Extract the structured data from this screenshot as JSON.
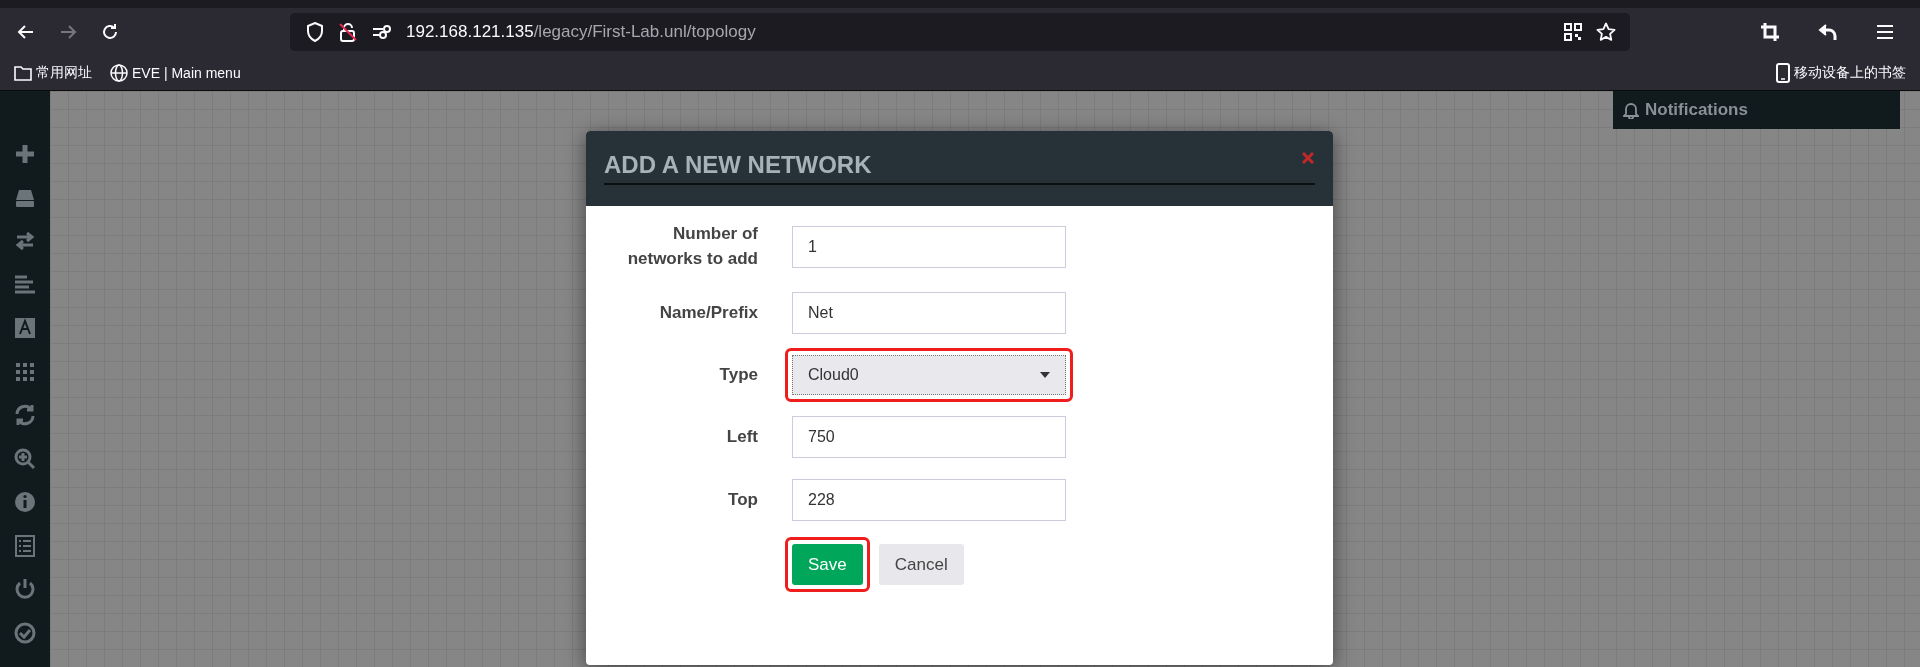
{
  "browser": {
    "nav_buttons": [
      {
        "kind": "back",
        "disabled": false
      },
      {
        "kind": "forward",
        "disabled": true
      },
      {
        "kind": "reload",
        "disabled": false
      }
    ],
    "url": {
      "host": "192.168.121.135",
      "path": "/legacy/First-Lab.unl/topology"
    },
    "bookmarks": [
      {
        "kind": "folder",
        "label": "常用网址"
      },
      {
        "kind": "site",
        "label": "EVE | Main menu"
      }
    ],
    "mobile_bookmarks": "移动设备上的书签"
  },
  "notifications": {
    "title": "Notifications"
  },
  "dialog": {
    "title": "ADD A NEW NETWORK",
    "fields": [
      {
        "kind": "text",
        "label": "Number of networks to add",
        "value": "1",
        "highlighted": false
      },
      {
        "kind": "text",
        "label": "Name/Prefix",
        "value": "Net",
        "highlighted": false
      },
      {
        "kind": "select",
        "label": "Type",
        "value": "Cloud0",
        "highlighted": true
      },
      {
        "kind": "text",
        "label": "Left",
        "value": "750",
        "highlighted": false
      },
      {
        "kind": "text",
        "label": "Top",
        "value": "228",
        "highlighted": false
      }
    ],
    "buttons": [
      {
        "kind": "primary",
        "label": "Save",
        "highlighted": true
      },
      {
        "kind": "secondary",
        "label": "Cancel",
        "highlighted": false
      }
    ]
  }
}
